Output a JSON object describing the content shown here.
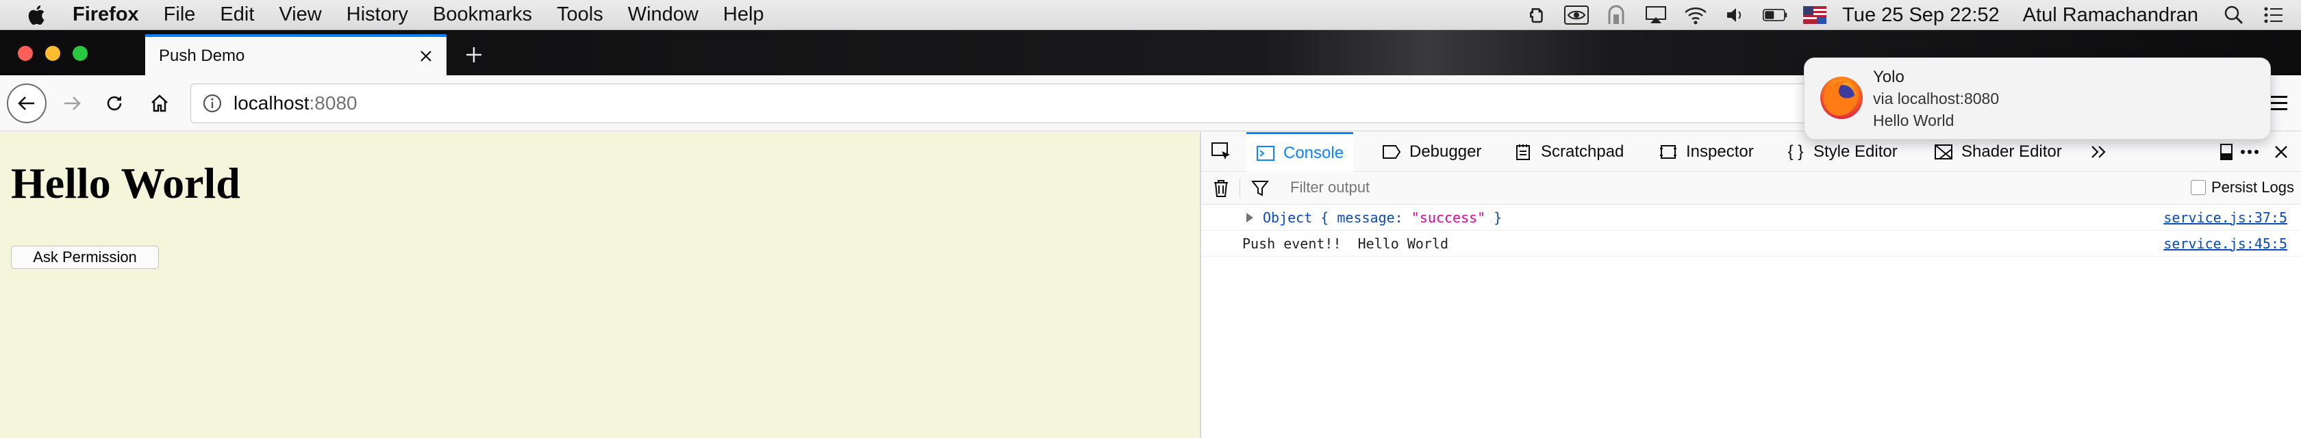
{
  "menubar": {
    "app_name": "Firefox",
    "items": [
      "File",
      "Edit",
      "View",
      "History",
      "Bookmarks",
      "Tools",
      "Window",
      "Help"
    ],
    "datetime": "Tue 25 Sep  22:52",
    "user": "Atul Ramachandran",
    "status_icons": [
      "evernote-icon",
      "nvidia-icon",
      "screen-recorder-icon",
      "airplay-icon",
      "wifi-icon",
      "volume-icon",
      "battery-icon",
      "input-source-flag-icon",
      "spotlight-search-icon",
      "notification-center-icon"
    ]
  },
  "browser": {
    "tab_title": "Push Demo",
    "url_host": "localhost",
    "url_port": ":8080",
    "accent": "#0a84ff"
  },
  "page": {
    "heading": "Hello World",
    "button_label": "Ask Permission",
    "background": "#f5f5dc"
  },
  "devtools": {
    "tabs": [
      "Console",
      "Debugger",
      "Scratchpad",
      "Inspector",
      "Style Editor",
      "Shader Editor"
    ],
    "selected_tab": "Console",
    "filter_placeholder": "Filter output",
    "persist_logs_label": "Persist Logs",
    "messages": [
      {
        "prefix": "Object { message: ",
        "string": "\"success\"",
        "suffix": " }",
        "source": "service.js:37:5",
        "expandable": true
      },
      {
        "text": "Push event!!  Hello World",
        "source": "service.js:45:5",
        "expandable": false
      }
    ]
  },
  "notification": {
    "title": "Yolo",
    "subtitle": "via localhost:8080",
    "body": "Hello World"
  }
}
